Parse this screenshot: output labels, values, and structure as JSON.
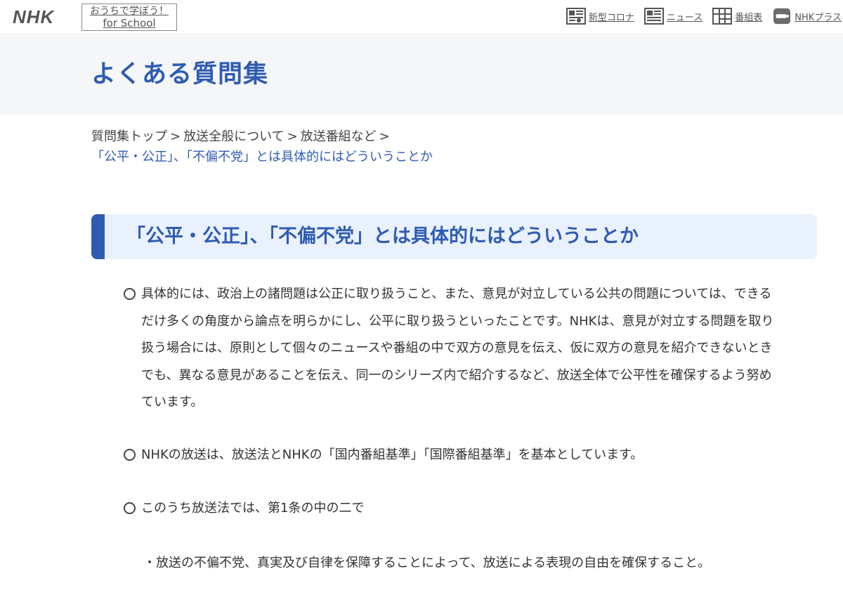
{
  "header": {
    "logo": "NHK",
    "school_line1": "おうちで学ぼう！",
    "school_line2": "for School",
    "nav": [
      {
        "label": "新型コロナ",
        "icon": "corona-info-icon"
      },
      {
        "label": "ニュース",
        "icon": "news-icon"
      },
      {
        "label": "番組表",
        "icon": "program-guide-icon"
      },
      {
        "label": "NHKプラス",
        "icon": "nhk-plus-icon"
      }
    ]
  },
  "page": {
    "title": "よくある質問集"
  },
  "breadcrumb": {
    "items": [
      "質問集トップ",
      "放送全般について",
      "放送番組など"
    ],
    "separator": ">",
    "current": "「公平・公正」、「不偏不党」とは具体的にはどういうことか"
  },
  "question": {
    "title": "「公平・公正」、「不偏不党」とは具体的にはどういうことか"
  },
  "answer": {
    "p1": "具体的には、政治上の諸問題は公正に取り扱うこと、また、意見が対立している公共の問題については、できるだけ多くの角度から論点を明らかにし、公平に取り扱うといったことです。NHKは、意見が対立する問題を取り扱う場合には、原則として個々のニュースや番組の中で双方の意見を伝え、仮に双方の意見を紹介できないときでも、異なる意見があることを伝え、同一のシリーズ内で紹介するなど、放送全体で公平性を確保するよう努めています。",
    "p2": "NHKの放送は、放送法とNHKの「国内番組基準」「国際番組基準」を基本としています。",
    "p3": "このうち放送法では、第1条の中の二で",
    "p4": "・放送の不偏不党、真実及び自律を保障することによって、放送による表現の自由を確保すること。"
  },
  "colors": {
    "accent": "#2f5cb2",
    "heading_bg": "#e9f1fc",
    "band_bg": "#f5f6f8"
  }
}
